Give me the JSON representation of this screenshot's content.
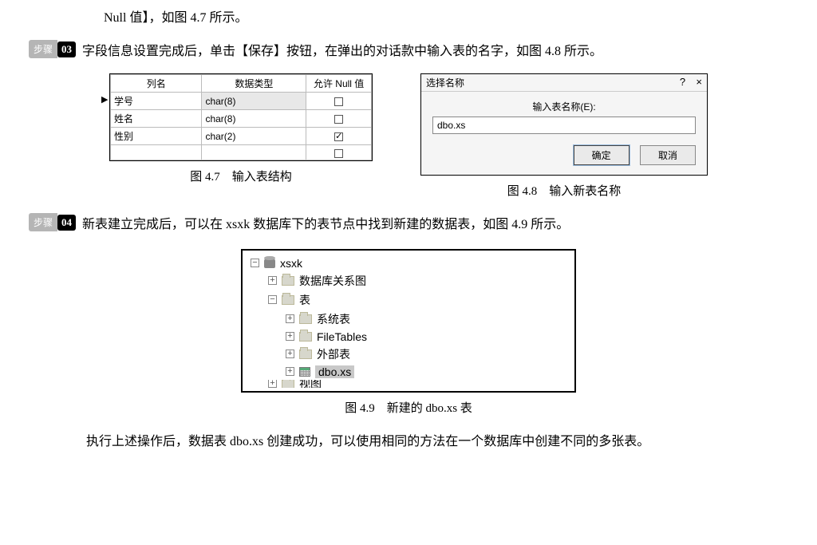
{
  "intro_line": "Null 值】，如图 4.7 所示。",
  "step03": {
    "badge_label": "步骤",
    "badge_num": "03",
    "text": "字段信息设置完成后，单击【保存】按钮，在弹出的对话款中输入表的名字，如图 4.8 所示。"
  },
  "fig47": {
    "headers": {
      "col_name": "列名",
      "col_type": "数据类型",
      "col_null": "允许 Null 值"
    },
    "rows": [
      {
        "marker": "▶",
        "name": "学号",
        "type": "char(8)",
        "null_checked": false,
        "selected": true
      },
      {
        "marker": "",
        "name": "姓名",
        "type": "char(8)",
        "null_checked": false,
        "selected": false
      },
      {
        "marker": "",
        "name": "性别",
        "type": "char(2)",
        "null_checked": true,
        "selected": false
      },
      {
        "marker": "",
        "name": "",
        "type": "",
        "null_checked": false,
        "selected": false
      }
    ],
    "caption": "图 4.7　输入表结构"
  },
  "fig48": {
    "title": "选择名称",
    "help_char": "?",
    "close_char": "×",
    "prompt": "输入表名称(E):",
    "value": "dbo.xs",
    "ok": "确定",
    "cancel": "取消",
    "caption": "图 4.8　输入新表名称"
  },
  "step04": {
    "badge_label": "步骤",
    "badge_num": "04",
    "text": "新表建立完成后，可以在 xsxk 数据库下的表节点中找到新建的数据表，如图 4.9 所示。"
  },
  "fig49": {
    "nodes": {
      "root": "xsxk",
      "n1": "数据库关系图",
      "n2": "表",
      "n2a": "系统表",
      "n2b": "FileTables",
      "n2c": "外部表",
      "n2d": "dbo.xs",
      "n3_cut": "视图"
    },
    "caption": "图 4.9　新建的 dbo.xs 表"
  },
  "closing": "执行上述操作后，数据表 dbo.xs 创建成功，可以使用相同的方法在一个数据库中创建不同的多张表。"
}
